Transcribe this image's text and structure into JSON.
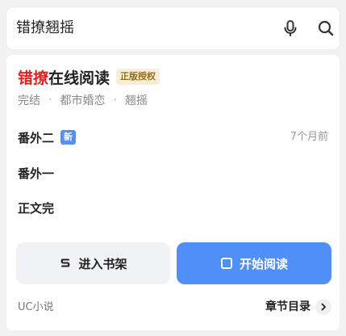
{
  "search": {
    "query": "错撩翘摇"
  },
  "result": {
    "title_highlight": "错撩",
    "title_rest": "在线阅读",
    "auth_badge": "正版授权",
    "meta": [
      "完结",
      "都市婚恋",
      "翘摇"
    ],
    "meta_separator": "·",
    "chapters": [
      {
        "name": "番外二",
        "badge": "新",
        "time": "7个月前"
      },
      {
        "name": "番外一"
      },
      {
        "name": "正文完"
      }
    ],
    "shelf_button": "进入书架",
    "read_button": "开始阅读",
    "source": "UC小说",
    "toc_link": "章节目录"
  },
  "colors": {
    "highlight": "#e02020",
    "primary": "#4f8ff7",
    "new_badge": "#5a8df0"
  },
  "icons": {
    "mic": "mic-icon",
    "search": "search-icon",
    "shelf": "bookshelf-icon",
    "read": "book-square-icon",
    "chevron": "chevron-right-icon"
  }
}
